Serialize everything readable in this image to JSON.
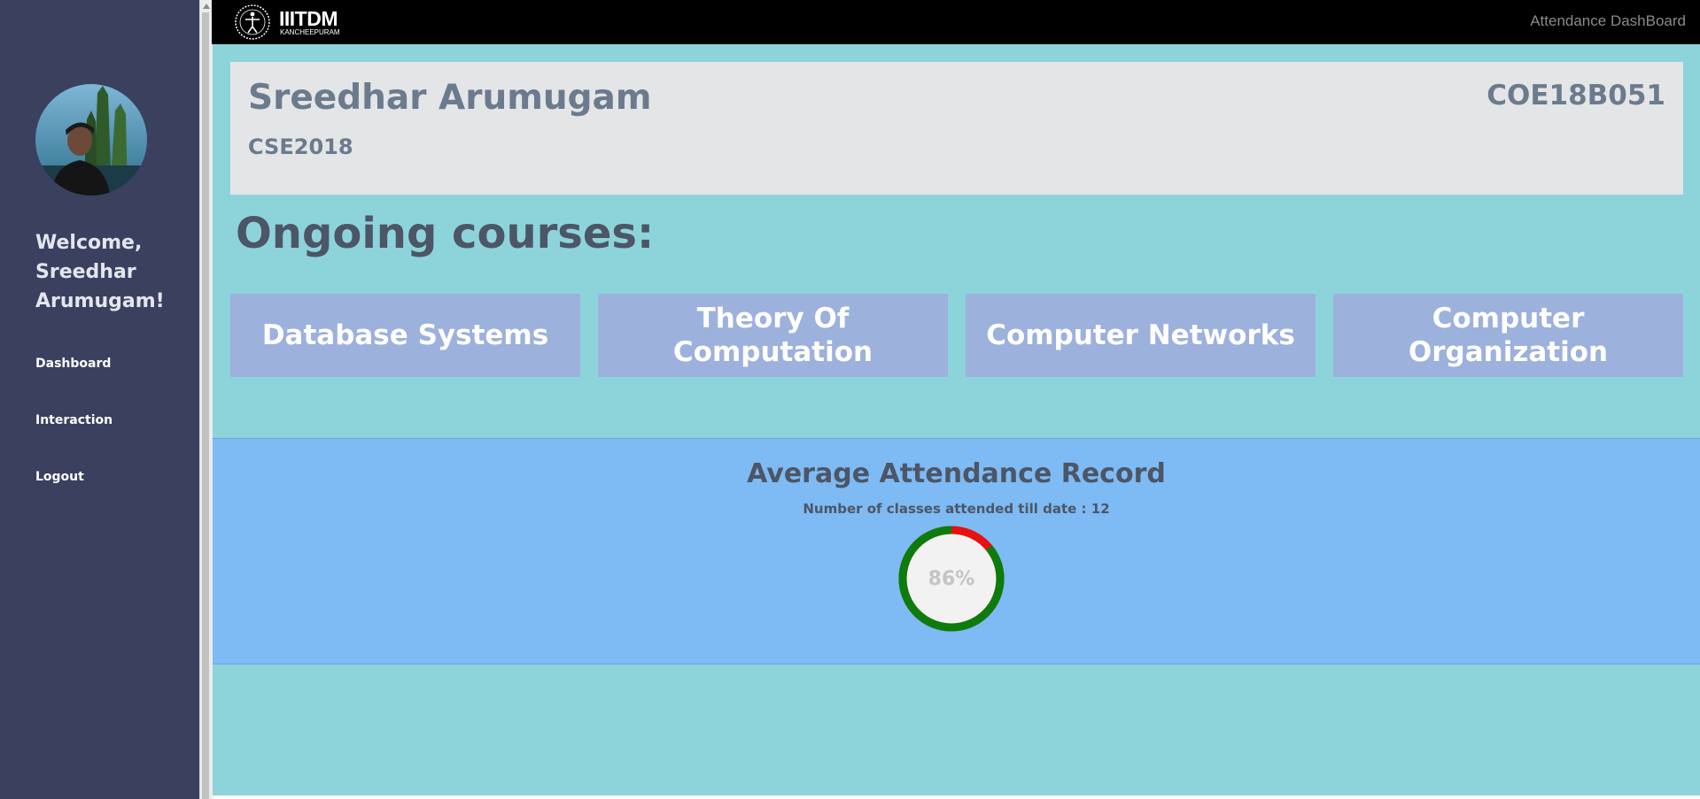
{
  "topbar": {
    "logo_name": "IIITDM",
    "logo_sub": "KANCHEEPURAM",
    "title": "Attendance DashBoard"
  },
  "sidebar": {
    "welcome": "Welcome, Sreedhar Arumugam!",
    "items": [
      {
        "label": "Dashboard"
      },
      {
        "label": "Interaction"
      },
      {
        "label": "Logout"
      }
    ]
  },
  "profile": {
    "name": "Sreedhar Arumugam",
    "batch": "CSE2018",
    "roll_number": "COE18B051"
  },
  "courses": {
    "heading": "Ongoing courses:",
    "items": [
      {
        "label": "Database Systems"
      },
      {
        "label": "Theory Of Computation"
      },
      {
        "label": "Computer Networks"
      },
      {
        "label": "Computer Organization"
      }
    ]
  },
  "attendance": {
    "title": "Average Attendance Record",
    "count_text": "Number of classes attended till date : 12",
    "percent_label": "86%",
    "percent_value": 86
  },
  "colors": {
    "attended": "#0c7c0c",
    "missed": "#e81010",
    "sidebar": "#3a405e",
    "main_background": "#8dd4da",
    "course_card": "#9cb1dc",
    "attendance_panel": "#7ebaf3"
  }
}
